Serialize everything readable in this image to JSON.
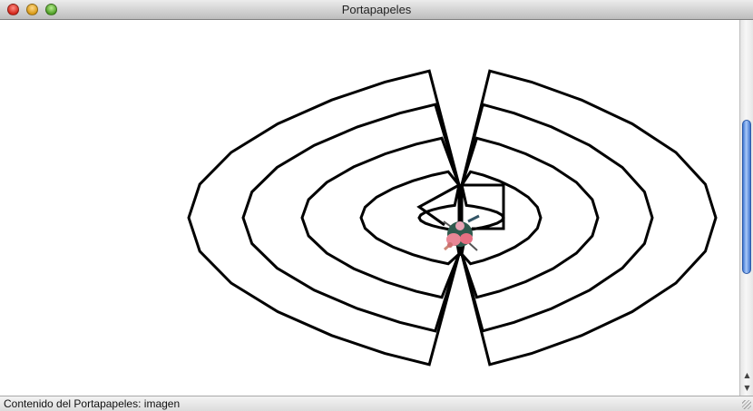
{
  "window": {
    "title": "Portapapeles"
  },
  "status": {
    "text": "Contenido del Portapapeles: imagen"
  },
  "clipboard": {
    "content_type": "imagen"
  }
}
